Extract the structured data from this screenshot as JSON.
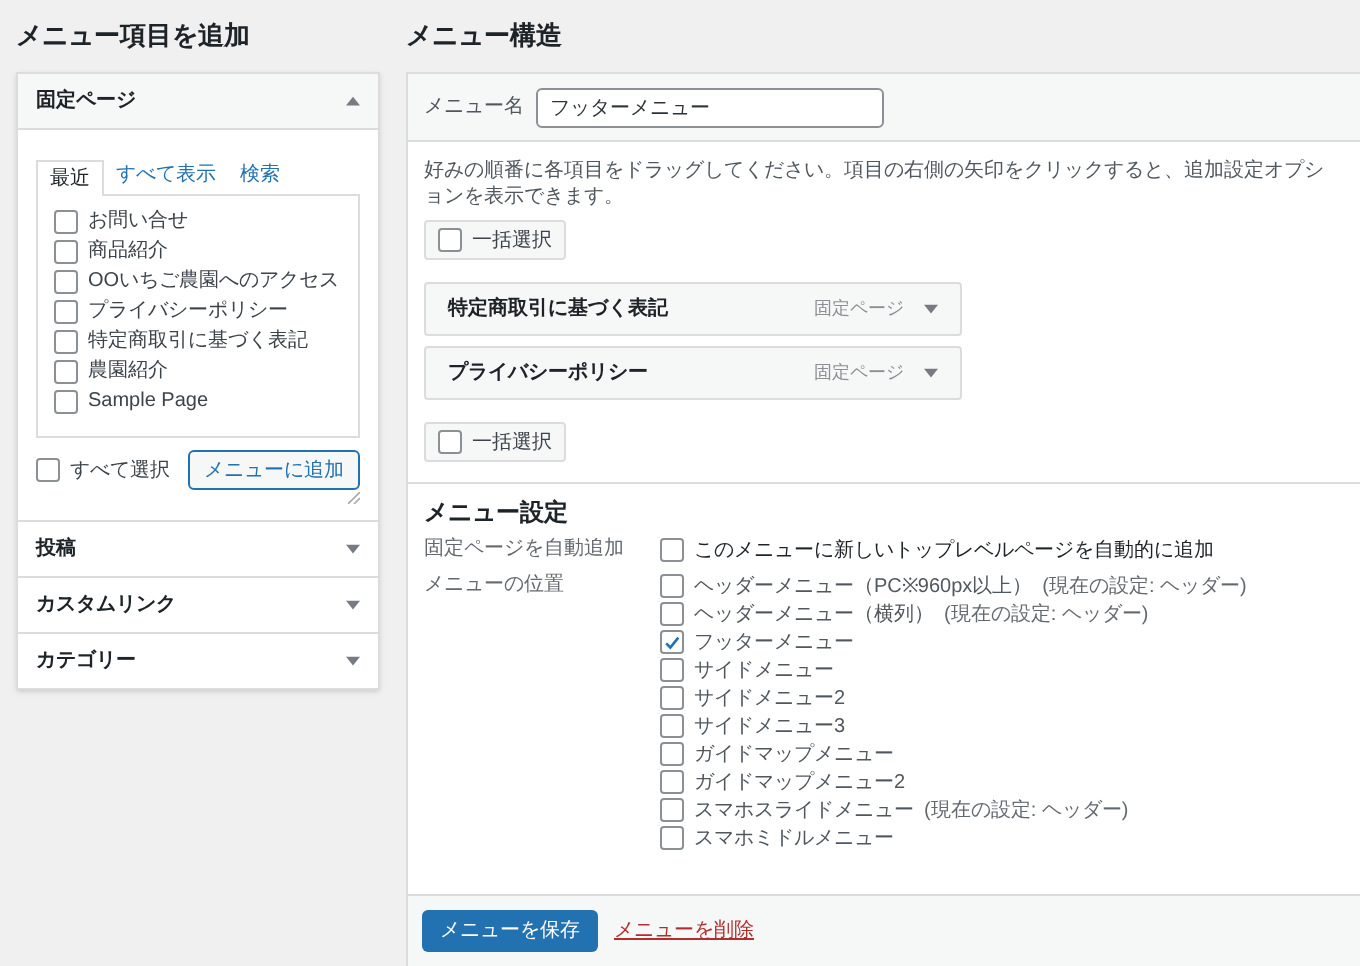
{
  "left": {
    "title": "メニュー項目を追加",
    "sections": [
      {
        "title": "固定ページ",
        "expanded": true
      },
      {
        "title": "投稿",
        "expanded": false
      },
      {
        "title": "カスタムリンク",
        "expanded": false
      },
      {
        "title": "カテゴリー",
        "expanded": false
      }
    ],
    "tabs": [
      {
        "label": "最近",
        "selected": true
      },
      {
        "label": "すべて表示",
        "selected": false
      },
      {
        "label": "検索",
        "selected": false
      }
    ],
    "pages": [
      {
        "label": "お問い合せ",
        "checked": false
      },
      {
        "label": "商品紹介",
        "checked": false
      },
      {
        "label": "OOいちご農園へのアクセス",
        "checked": false
      },
      {
        "label": "プライバシーポリシー",
        "checked": false
      },
      {
        "label": "特定商取引に基づく表記",
        "checked": false
      },
      {
        "label": "農園紹介",
        "checked": false
      },
      {
        "label": "Sample Page",
        "checked": false
      }
    ],
    "select_all": {
      "label": "すべて選択",
      "checked": false
    },
    "add_button": "メニューに追加"
  },
  "right": {
    "title": "メニュー構造",
    "menu_name_label": "メニュー名",
    "menu_name": "フッターメニュー",
    "instructions": "好みの順番に各項目をドラッグしてください。項目の右側の矢印をクリックすると、追加設定オプションを表示できます。",
    "bulk_select": [
      {
        "label": "一括選択",
        "checked": false
      },
      {
        "label": "一括選択",
        "checked": false
      }
    ],
    "items": [
      {
        "title": "特定商取引に基づく表記",
        "type": "固定ページ"
      },
      {
        "title": "プライバシーポリシー",
        "type": "固定ページ"
      }
    ],
    "settings_title": "メニュー設定",
    "auto_add": {
      "label": "固定ページを自動追加",
      "option": "このメニューに新しいトップレベルページを自動的に追加",
      "checked": false
    },
    "locations_label": "メニューの位置",
    "locations": [
      {
        "label": "ヘッダーメニュー（PC※960px以上）",
        "note": "(現在の設定: ヘッダー)",
        "checked": false
      },
      {
        "label": "ヘッダーメニュー（横列）",
        "note": "(現在の設定: ヘッダー)",
        "checked": false
      },
      {
        "label": "フッターメニュー",
        "checked": true
      },
      {
        "label": "サイドメニュー",
        "checked": false
      },
      {
        "label": "サイドメニュー2",
        "checked": false
      },
      {
        "label": "サイドメニュー3",
        "checked": false
      },
      {
        "label": "ガイドマップメニュー",
        "checked": false
      },
      {
        "label": "ガイドマップメニュー2",
        "checked": false
      },
      {
        "label": "スマホスライドメニュー",
        "note": "(現在の設定: ヘッダー)",
        "checked": false
      },
      {
        "label": "スマホミドルメニュー",
        "checked": false
      }
    ],
    "save_button": "メニューを保存",
    "delete_link": "メニューを削除"
  }
}
